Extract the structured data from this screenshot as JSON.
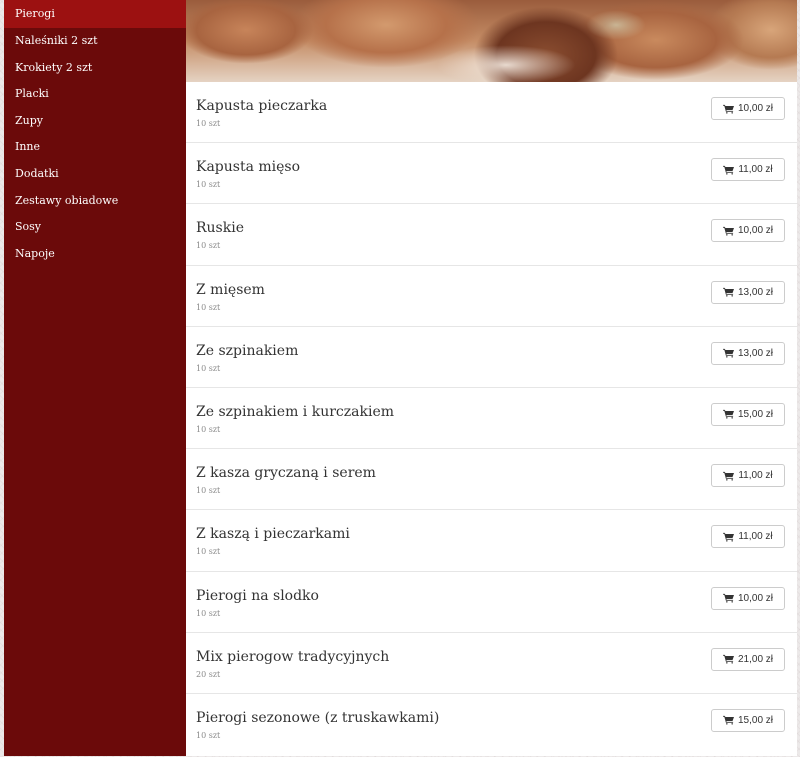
{
  "sidebar": {
    "items": [
      {
        "label": "Pierogi",
        "active": true
      },
      {
        "label": "Naleśniki 2 szt",
        "active": false
      },
      {
        "label": "Krokiety 2 szt",
        "active": false
      },
      {
        "label": "Placki",
        "active": false
      },
      {
        "label": "Zupy",
        "active": false
      },
      {
        "label": "Inne",
        "active": false
      },
      {
        "label": "Dodatki",
        "active": false
      },
      {
        "label": "Zestawy obiadowe",
        "active": false
      },
      {
        "label": "Sosy",
        "active": false
      },
      {
        "label": "Napoje",
        "active": false
      }
    ]
  },
  "menu": {
    "items": [
      {
        "name": "Kapusta pieczarka",
        "qty": "10 szt",
        "price": "10,00 zł"
      },
      {
        "name": "Kapusta mięso",
        "qty": "10 szt",
        "price": "11,00 zł"
      },
      {
        "name": "Ruskie",
        "qty": "10 szt",
        "price": "10,00 zł"
      },
      {
        "name": "Z mięsem",
        "qty": "10 szt",
        "price": "13,00 zł"
      },
      {
        "name": "Ze szpinakiem",
        "qty": "10 szt",
        "price": "13,00 zł"
      },
      {
        "name": "Ze szpinakiem i kurczakiem",
        "qty": "10 szt",
        "price": "15,00 zł"
      },
      {
        "name": "Z kasza gryczaną i serem",
        "qty": "10 szt",
        "price": "11,00 zł"
      },
      {
        "name": "Z kaszą i pieczarkami",
        "qty": "10 szt",
        "price": "11,00 zł"
      },
      {
        "name": "Pierogi na slodko",
        "qty": "10 szt",
        "price": "10,00 zł"
      },
      {
        "name": "Mix pierogow tradycyjnych",
        "qty": "20 szt",
        "price": "21,00 zł"
      },
      {
        "name": "Pierogi sezonowe (z truskawkami)",
        "qty": "10 szt",
        "price": "15,00 zł"
      }
    ]
  },
  "icons": {
    "price_button": "cart-icon"
  },
  "colors": {
    "sidebar_bg": "#6b0a0a",
    "sidebar_active": "#9c1111",
    "page_bg": "#ece9e9"
  }
}
